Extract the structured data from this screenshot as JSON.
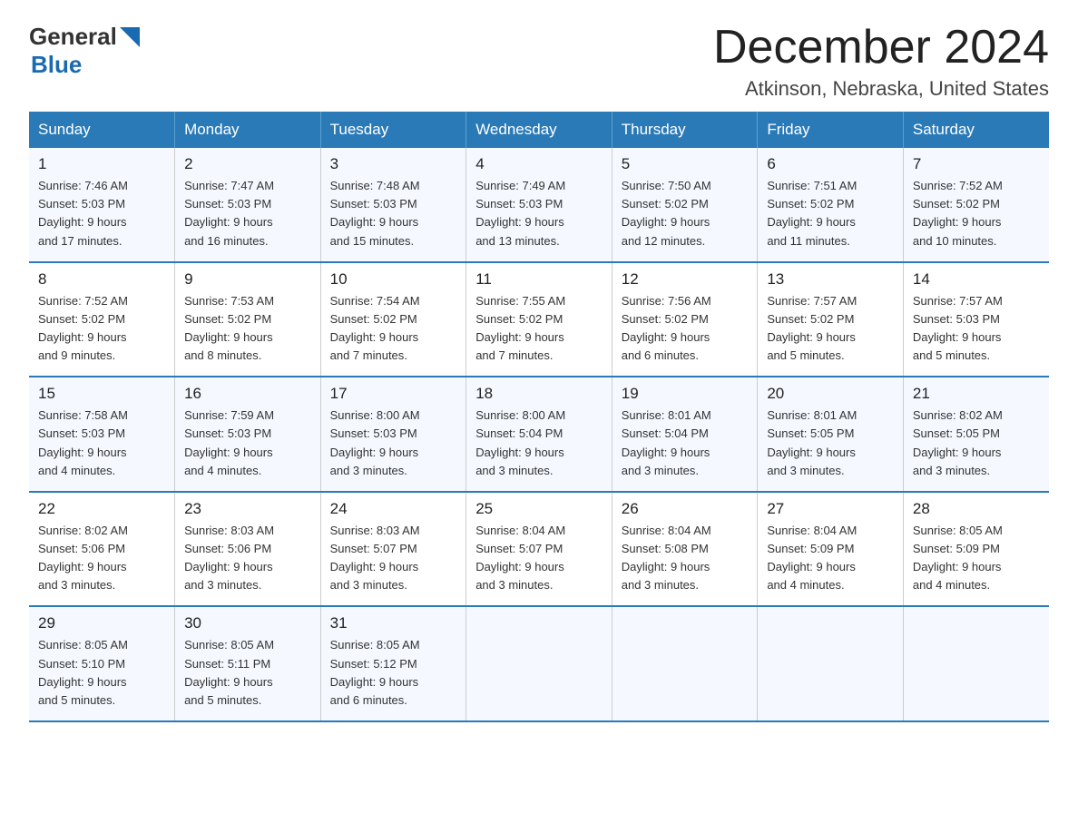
{
  "logo": {
    "general": "General",
    "blue": "Blue"
  },
  "header": {
    "month": "December 2024",
    "location": "Atkinson, Nebraska, United States"
  },
  "weekdays": [
    "Sunday",
    "Monday",
    "Tuesday",
    "Wednesday",
    "Thursday",
    "Friday",
    "Saturday"
  ],
  "weeks": [
    [
      {
        "day": "1",
        "sunrise": "7:46 AM",
        "sunset": "5:03 PM",
        "daylight": "9 hours and 17 minutes."
      },
      {
        "day": "2",
        "sunrise": "7:47 AM",
        "sunset": "5:03 PM",
        "daylight": "9 hours and 16 minutes."
      },
      {
        "day": "3",
        "sunrise": "7:48 AM",
        "sunset": "5:03 PM",
        "daylight": "9 hours and 15 minutes."
      },
      {
        "day": "4",
        "sunrise": "7:49 AM",
        "sunset": "5:03 PM",
        "daylight": "9 hours and 13 minutes."
      },
      {
        "day": "5",
        "sunrise": "7:50 AM",
        "sunset": "5:02 PM",
        "daylight": "9 hours and 12 minutes."
      },
      {
        "day": "6",
        "sunrise": "7:51 AM",
        "sunset": "5:02 PM",
        "daylight": "9 hours and 11 minutes."
      },
      {
        "day": "7",
        "sunrise": "7:52 AM",
        "sunset": "5:02 PM",
        "daylight": "9 hours and 10 minutes."
      }
    ],
    [
      {
        "day": "8",
        "sunrise": "7:52 AM",
        "sunset": "5:02 PM",
        "daylight": "9 hours and 9 minutes."
      },
      {
        "day": "9",
        "sunrise": "7:53 AM",
        "sunset": "5:02 PM",
        "daylight": "9 hours and 8 minutes."
      },
      {
        "day": "10",
        "sunrise": "7:54 AM",
        "sunset": "5:02 PM",
        "daylight": "9 hours and 7 minutes."
      },
      {
        "day": "11",
        "sunrise": "7:55 AM",
        "sunset": "5:02 PM",
        "daylight": "9 hours and 7 minutes."
      },
      {
        "day": "12",
        "sunrise": "7:56 AM",
        "sunset": "5:02 PM",
        "daylight": "9 hours and 6 minutes."
      },
      {
        "day": "13",
        "sunrise": "7:57 AM",
        "sunset": "5:02 PM",
        "daylight": "9 hours and 5 minutes."
      },
      {
        "day": "14",
        "sunrise": "7:57 AM",
        "sunset": "5:03 PM",
        "daylight": "9 hours and 5 minutes."
      }
    ],
    [
      {
        "day": "15",
        "sunrise": "7:58 AM",
        "sunset": "5:03 PM",
        "daylight": "9 hours and 4 minutes."
      },
      {
        "day": "16",
        "sunrise": "7:59 AM",
        "sunset": "5:03 PM",
        "daylight": "9 hours and 4 minutes."
      },
      {
        "day": "17",
        "sunrise": "8:00 AM",
        "sunset": "5:03 PM",
        "daylight": "9 hours and 3 minutes."
      },
      {
        "day": "18",
        "sunrise": "8:00 AM",
        "sunset": "5:04 PM",
        "daylight": "9 hours and 3 minutes."
      },
      {
        "day": "19",
        "sunrise": "8:01 AM",
        "sunset": "5:04 PM",
        "daylight": "9 hours and 3 minutes."
      },
      {
        "day": "20",
        "sunrise": "8:01 AM",
        "sunset": "5:05 PM",
        "daylight": "9 hours and 3 minutes."
      },
      {
        "day": "21",
        "sunrise": "8:02 AM",
        "sunset": "5:05 PM",
        "daylight": "9 hours and 3 minutes."
      }
    ],
    [
      {
        "day": "22",
        "sunrise": "8:02 AM",
        "sunset": "5:06 PM",
        "daylight": "9 hours and 3 minutes."
      },
      {
        "day": "23",
        "sunrise": "8:03 AM",
        "sunset": "5:06 PM",
        "daylight": "9 hours and 3 minutes."
      },
      {
        "day": "24",
        "sunrise": "8:03 AM",
        "sunset": "5:07 PM",
        "daylight": "9 hours and 3 minutes."
      },
      {
        "day": "25",
        "sunrise": "8:04 AM",
        "sunset": "5:07 PM",
        "daylight": "9 hours and 3 minutes."
      },
      {
        "day": "26",
        "sunrise": "8:04 AM",
        "sunset": "5:08 PM",
        "daylight": "9 hours and 3 minutes."
      },
      {
        "day": "27",
        "sunrise": "8:04 AM",
        "sunset": "5:09 PM",
        "daylight": "9 hours and 4 minutes."
      },
      {
        "day": "28",
        "sunrise": "8:05 AM",
        "sunset": "5:09 PM",
        "daylight": "9 hours and 4 minutes."
      }
    ],
    [
      {
        "day": "29",
        "sunrise": "8:05 AM",
        "sunset": "5:10 PM",
        "daylight": "9 hours and 5 minutes."
      },
      {
        "day": "30",
        "sunrise": "8:05 AM",
        "sunset": "5:11 PM",
        "daylight": "9 hours and 5 minutes."
      },
      {
        "day": "31",
        "sunrise": "8:05 AM",
        "sunset": "5:12 PM",
        "daylight": "9 hours and 6 minutes."
      },
      null,
      null,
      null,
      null
    ]
  ],
  "labels": {
    "sunrise": "Sunrise:",
    "sunset": "Sunset:",
    "daylight": "Daylight:"
  }
}
